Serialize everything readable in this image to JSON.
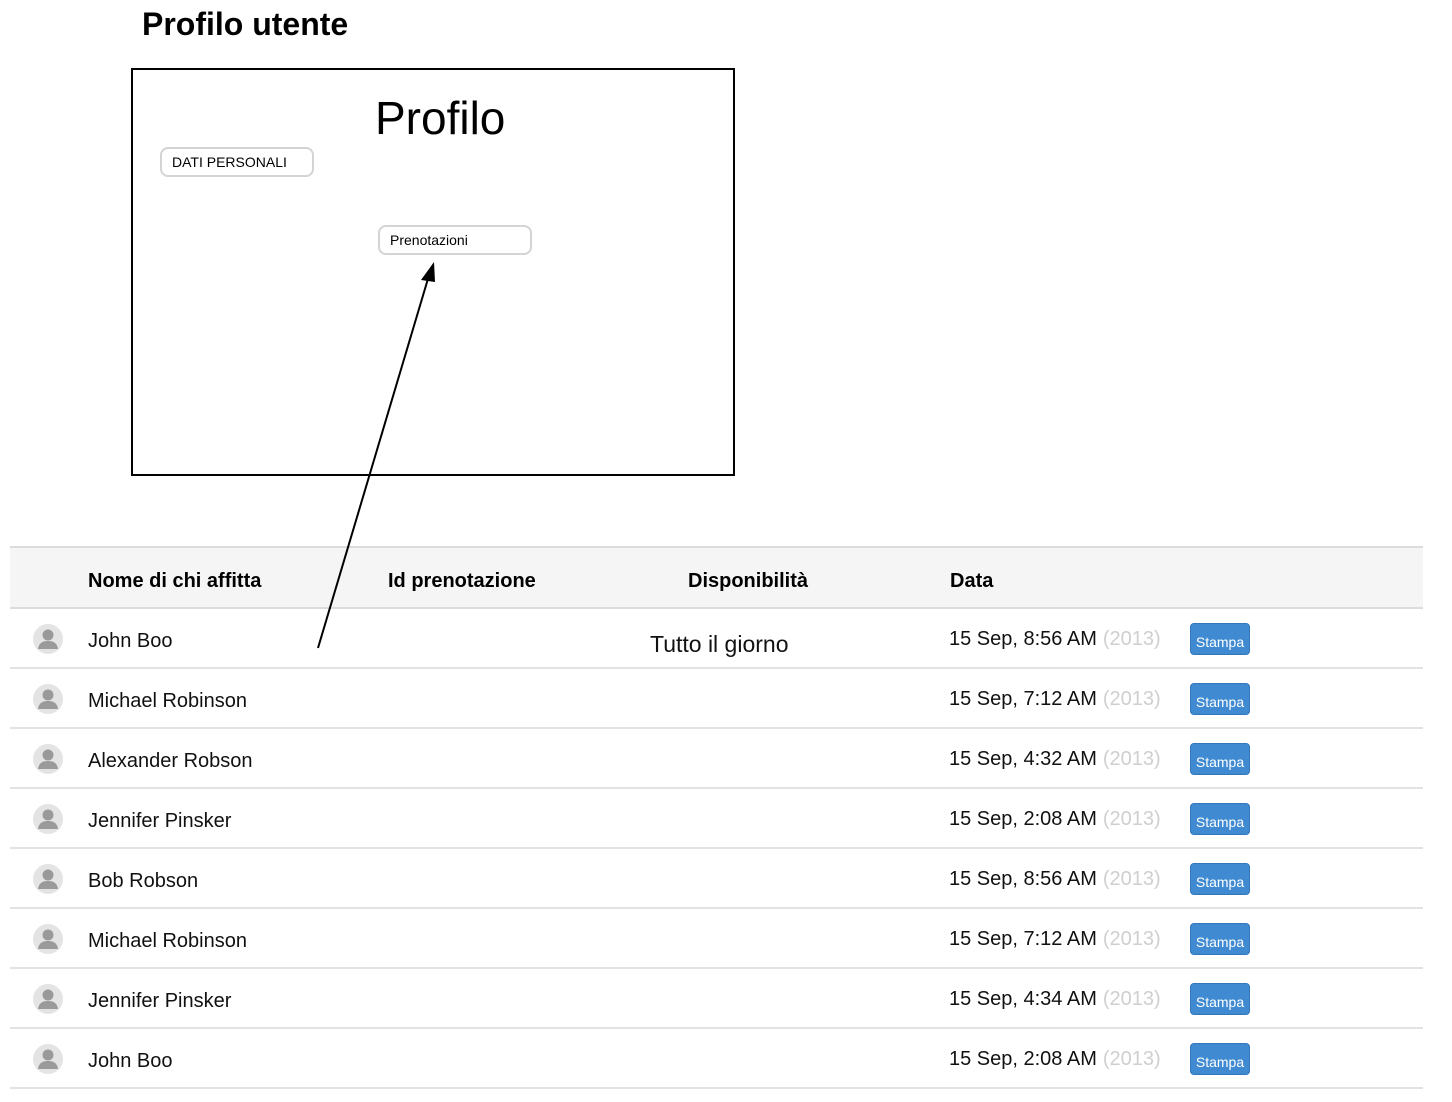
{
  "page_title": "Profilo utente",
  "mockup": {
    "heading": "Profilo",
    "personal_data_button": "DATI PERSONALI",
    "bookings_button": "Prenotazioni"
  },
  "table": {
    "headers": {
      "name": "Nome di chi affitta",
      "id": "Id prenotazione",
      "availability": "Disponibilità",
      "date": "Data"
    },
    "rows": [
      {
        "name": "John Boo",
        "availability": "Tutto il giorno",
        "date": "15 Sep, 8:56 AM",
        "year": "(2013)",
        "action": "Stampa"
      },
      {
        "name": "Michael Robinson",
        "availability": "",
        "date": "15 Sep, 7:12 AM",
        "year": "(2013)",
        "action": "Stampa"
      },
      {
        "name": "Alexander Robson",
        "availability": "",
        "date": "15 Sep, 4:32 AM",
        "year": "(2013)",
        "action": "Stampa"
      },
      {
        "name": "Jennifer Pinsker",
        "availability": "",
        "date": "15 Sep, 2:08 AM",
        "year": "(2013)",
        "action": "Stampa"
      },
      {
        "name": "Bob Robson",
        "availability": "",
        "date": "15 Sep, 8:56 AM",
        "year": "(2013)",
        "action": "Stampa"
      },
      {
        "name": "Michael Robinson",
        "availability": "",
        "date": "15 Sep, 7:12 AM",
        "year": "(2013)",
        "action": "Stampa"
      },
      {
        "name": "Jennifer Pinsker",
        "availability": "",
        "date": "15 Sep, 4:34 AM",
        "year": "(2013)",
        "action": "Stampa"
      },
      {
        "name": "John Boo",
        "availability": "",
        "date": "15 Sep, 2:08 AM",
        "year": "(2013)",
        "action": "Stampa"
      }
    ]
  },
  "colors": {
    "button_blue": "#3f8ad0",
    "year_gray": "#cfcfcf",
    "header_bg": "#f5f5f5"
  }
}
